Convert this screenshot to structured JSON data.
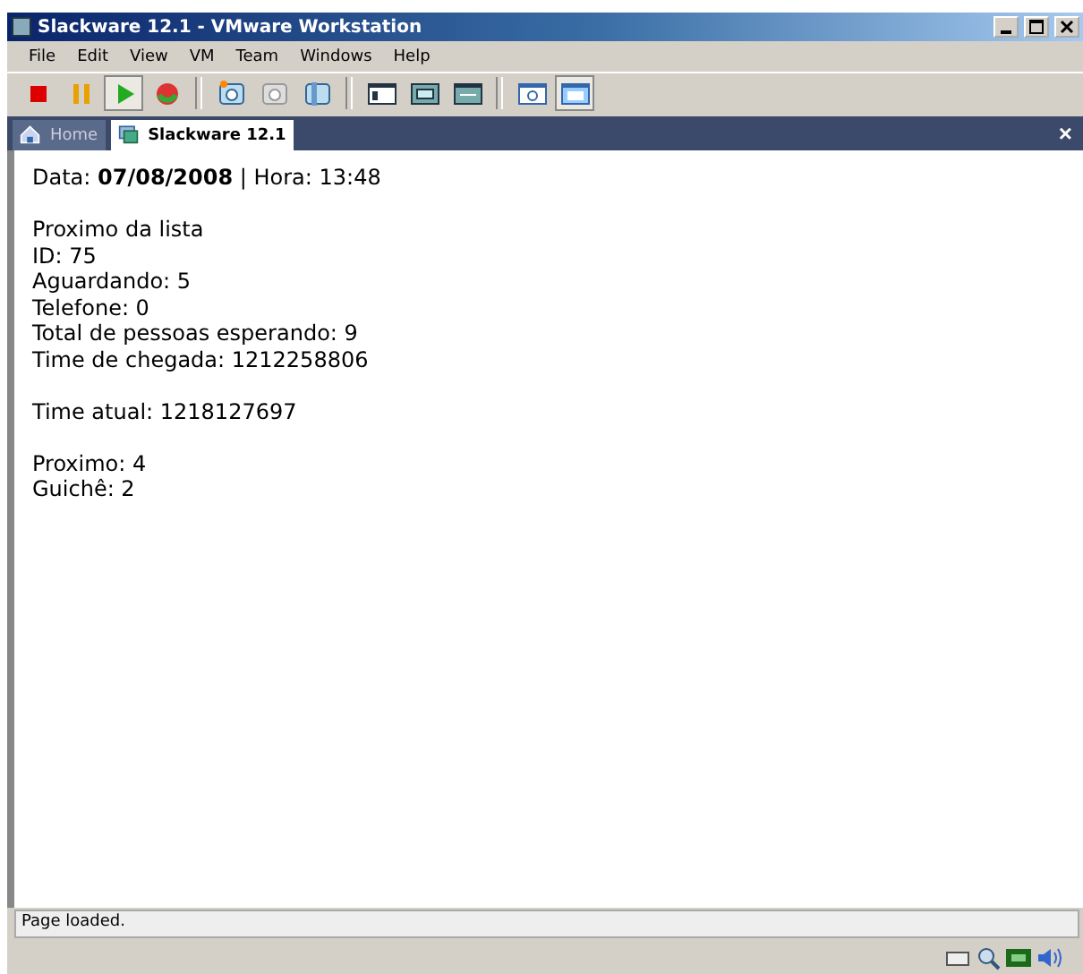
{
  "window": {
    "title": "Slackware 12.1 - VMware Workstation"
  },
  "menu": [
    "File",
    "Edit",
    "View",
    "VM",
    "Team",
    "Windows",
    "Help"
  ],
  "toolbar": [
    [
      {
        "kind": "stop",
        "pressed": false
      },
      {
        "kind": "pause",
        "pressed": false
      },
      {
        "kind": "play",
        "pressed": true
      },
      {
        "kind": "reset",
        "pressed": false
      }
    ],
    [
      {
        "kind": "snapshot",
        "pressed": false
      },
      {
        "kind": "revert",
        "pressed": false
      },
      {
        "kind": "manager",
        "pressed": false
      }
    ],
    [
      {
        "kind": "sidebar",
        "pressed": false
      },
      {
        "kind": "fullscreen",
        "pressed": false
      },
      {
        "kind": "fit",
        "pressed": false
      }
    ],
    [
      {
        "kind": "quickswitch",
        "pressed": false
      },
      {
        "kind": "console",
        "pressed": true
      }
    ]
  ],
  "tabs": [
    {
      "label": "Home",
      "kind": "home",
      "selected": false
    },
    {
      "label": "Slackware 12.1",
      "kind": "vm",
      "selected": true
    }
  ],
  "close_tab": "×",
  "content": [
    [
      "Data: **07/08/2008** | Hora: 13:48"
    ],
    [
      "Proximo da lista",
      "ID: 75",
      "Aguardando: 5",
      "Telefone: 0",
      "Total de pessoas esperando: 9",
      "Time de chegada: 1212258806"
    ],
    [
      "Time atual: 1218127697"
    ],
    [
      "Proximo: 4",
      "Guichê: 2"
    ]
  ],
  "status_bar": "Page loaded."
}
